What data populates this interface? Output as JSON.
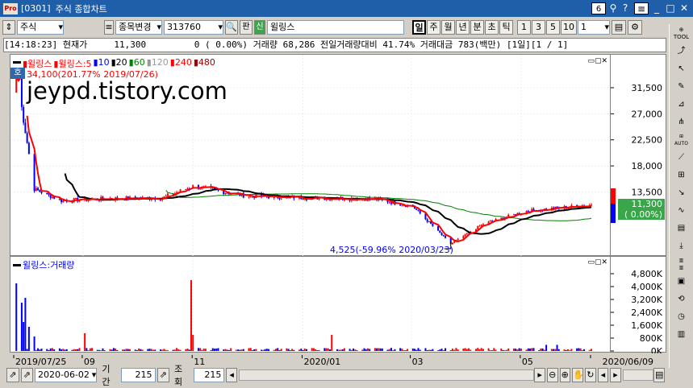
{
  "window": {
    "code": "[0301]",
    "title": "주식 종합차트",
    "num_badge": "6"
  },
  "toolbar": {
    "market": "주식",
    "change_label": "종목변경",
    "stock_code": "313760",
    "pan_label": "판",
    "sin_label": "신",
    "stock_name": "윌링스",
    "periods": [
      "일",
      "주",
      "월",
      "년",
      "분",
      "초",
      "틱"
    ],
    "active_period": "일",
    "nums": [
      "1",
      "3",
      "5",
      "10"
    ],
    "count_value": "1"
  },
  "quote": {
    "time": "[14:18:23]",
    "price_label": "현재가",
    "price": "11,300",
    "change": "0",
    "change_pct": "( 0.00%)",
    "vol_label": "거래량",
    "volume": "68,286",
    "prev_label": "전일거래량대비",
    "prev_ratio": "41.74%",
    "amount_label": "거래대금",
    "amount": "783(백만)",
    "period_info": "[1일][1 / 1]"
  },
  "price_panel": {
    "legend": [
      {
        "text": "윌링스",
        "color": "#ff0000"
      },
      {
        "text": "윌링스:5",
        "color": "#ff0000"
      },
      {
        "text": "10",
        "color": "#0000ff"
      },
      {
        "text": "20",
        "color": "#000000"
      },
      {
        "text": "60",
        "color": "#008000"
      },
      {
        "text": "120",
        "color": "#999999"
      },
      {
        "text": "240",
        "color": "#ff0000"
      },
      {
        "text": "480",
        "color": "#a00000"
      }
    ],
    "ho_badge": "호",
    "high_note": "34,100(201.77% 2019/07/26)",
    "low_note": "4,525(-59.96% 2020/03/23)",
    "watermark": "jeypd.tistory.com",
    "price_tag": "11,300",
    "pct_tag": "( 0.00%)",
    "y_ticks": [
      "31,500",
      "27,000",
      "22,500",
      "18,000",
      "13,500"
    ]
  },
  "volume_panel": {
    "legend": "윌링스:거래량",
    "y_ticks": [
      "4,800K",
      "4,000K",
      "3,200K",
      "2,400K",
      "1,600K",
      "800K",
      "0K"
    ]
  },
  "x_axis": {
    "labels": [
      "2019/07/25",
      "09",
      "11",
      "2020/01",
      "03",
      "05",
      "2020/06/09"
    ]
  },
  "bottom": {
    "date": "2020-06-02",
    "period_label": "기간",
    "period_value": "215",
    "query_label": "조회",
    "query_value": "215"
  },
  "colors": {
    "up": "#ff0000",
    "down": "#0000ff",
    "ma5": "#ff0000",
    "ma20": "#000000",
    "ma60": "#008000",
    "ma120": "#999999"
  },
  "chart_data": {
    "type": "line",
    "title": "",
    "x_range": [
      "2019/07/25",
      "2020/06/09"
    ],
    "ylim": [
      4525,
      34100
    ],
    "series": [
      {
        "name": "윌링스",
        "dates": [
          "2019/07/26",
          "2019/08/05",
          "2019/08/20",
          "2019/09/10",
          "2019/10/15",
          "2019/11/01",
          "2019/12/01",
          "2020/01/06",
          "2020/02/10",
          "2020/03/02",
          "2020/03/23",
          "2020/04/10",
          "2020/05/04",
          "2020/06/09"
        ],
        "values": [
          34100,
          14000,
          12000,
          12300,
          12500,
          14500,
          12800,
          12500,
          12300,
          11000,
          4525,
          8000,
          10200,
          11300
        ]
      }
    ],
    "volume_ylim": [
      0,
      4800000
    ],
    "volume_ticks": [
      800000,
      1600000,
      2400000,
      3200000,
      4000000,
      4800000
    ]
  }
}
